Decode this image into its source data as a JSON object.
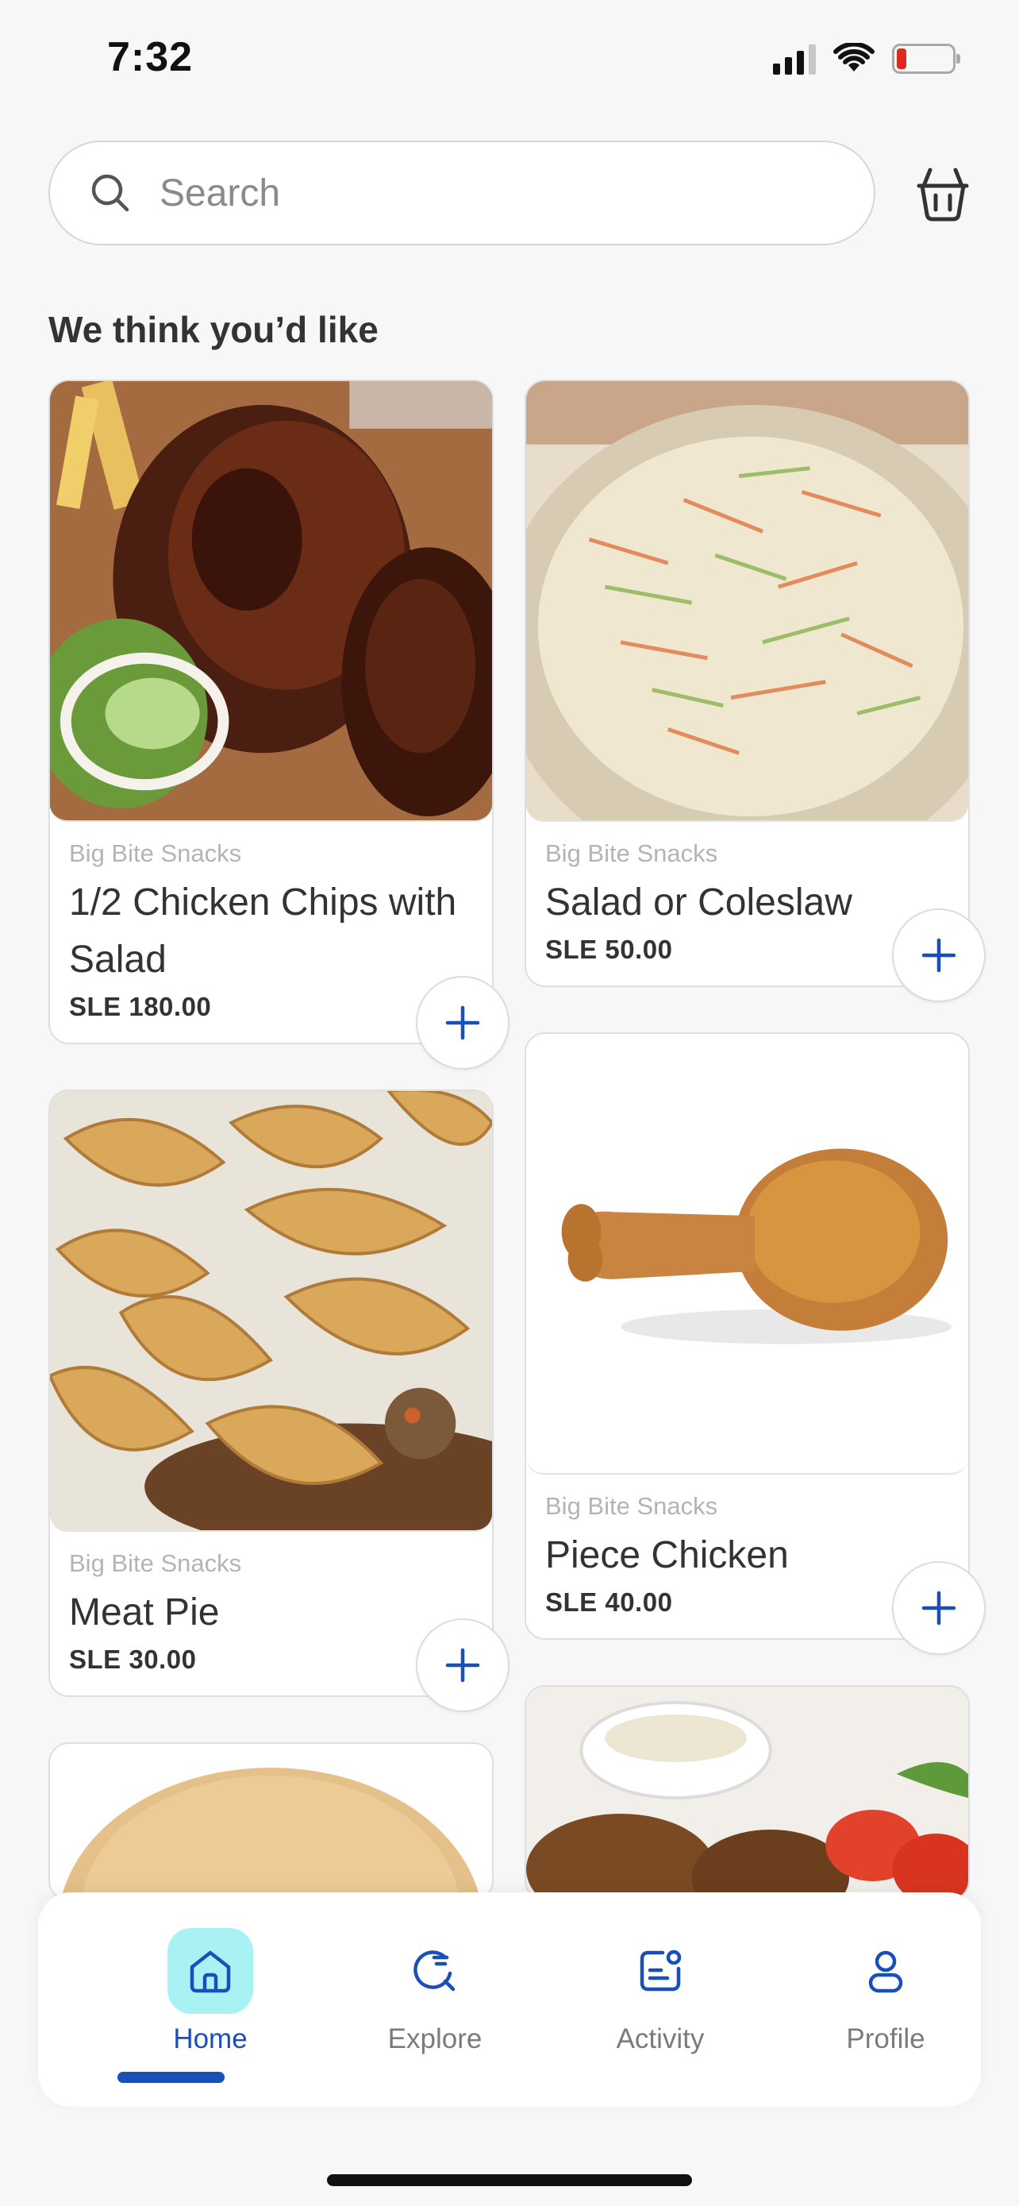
{
  "status_bar": {
    "time": "7:32"
  },
  "search": {
    "placeholder": "Search"
  },
  "section": {
    "title": "We think you’d like"
  },
  "products": [
    {
      "vendor": "Big Bite Snacks",
      "name": "1/2 Chicken Chips with Salad",
      "price": "SLE 180.00",
      "image": "grilled-chicken-photo"
    },
    {
      "vendor": "Big Bite Snacks",
      "name": "Salad or Coleslaw",
      "price": "SLE 50.00",
      "image": "coleslaw-photo"
    },
    {
      "vendor": "Big Bite Snacks",
      "name": "Meat Pie",
      "price": "SLE 30.00",
      "image": "meat-pie-photo"
    },
    {
      "vendor": "Big Bite Snacks",
      "name": "Piece Chicken",
      "price": "SLE 40.00",
      "image": "fried-chicken-drumstick-photo"
    },
    {
      "image": "bread-bun-photo"
    },
    {
      "image": "kebab-plate-photo"
    }
  ],
  "nav": {
    "items": [
      {
        "label": "Home",
        "icon": "home-icon",
        "active": true
      },
      {
        "label": "Explore",
        "icon": "explore-icon",
        "active": false
      },
      {
        "label": "Activity",
        "icon": "activity-icon",
        "active": false
      },
      {
        "label": "Profile",
        "icon": "profile-icon",
        "active": false
      }
    ]
  },
  "colors": {
    "accent": "#1a4fb8",
    "active_tab_bg": "#a9f2f3",
    "battery_low": "#e0291f",
    "background": "#f7f7f8"
  }
}
